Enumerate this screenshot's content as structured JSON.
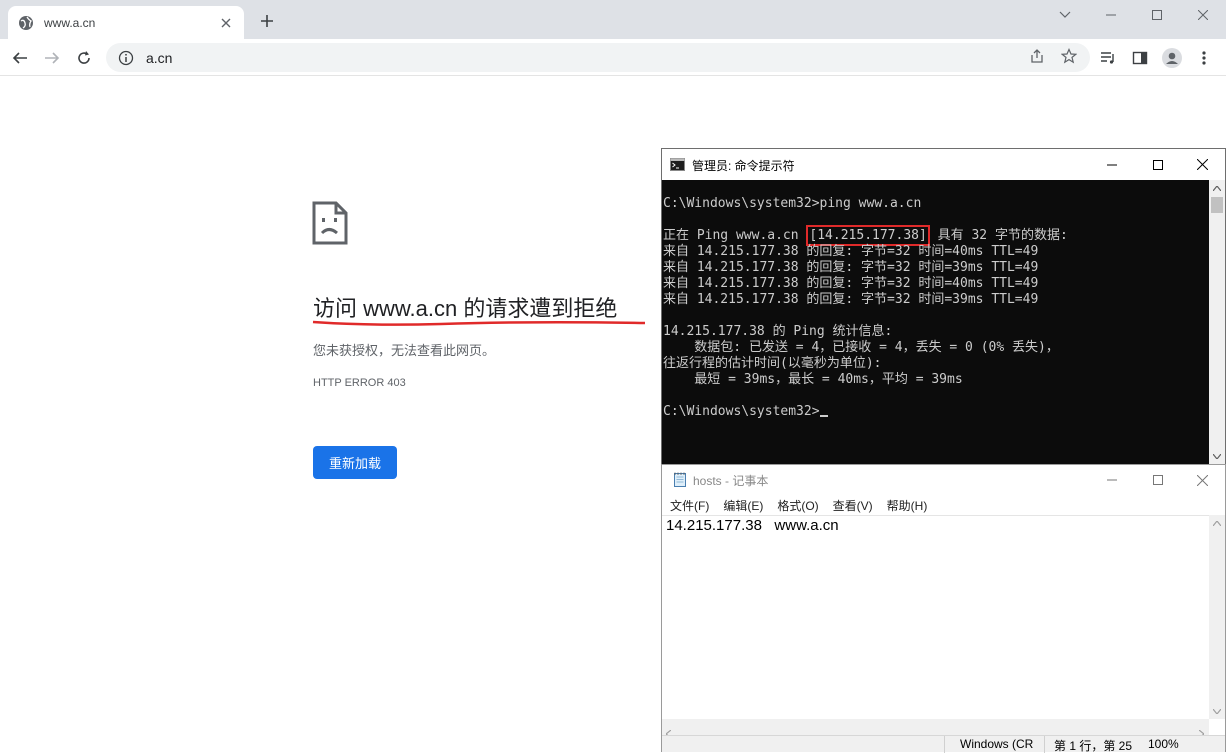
{
  "browser": {
    "tab_title": "www.a.cn",
    "url": "a.cn"
  },
  "error_page": {
    "title": "访问 www.a.cn 的请求遭到拒绝",
    "subtitle": "您未获授权，无法查看此网页。",
    "code": "HTTP ERROR 403",
    "reload_label": "重新加载",
    "underline_color": "#e02a2a"
  },
  "cmd": {
    "title": "管理员: 命令提示符",
    "lines": {
      "l1": "C:\\Windows\\system32>ping www.a.cn",
      "l3_pre": "正在 Ping www.a.cn ",
      "l3_ip": "[14.215.177.38]",
      "l3_post": " 具有 32 字节的数据:",
      "l4": "来自 14.215.177.38 的回复: 字节=32 时间=40ms TTL=49",
      "l5": "来自 14.215.177.38 的回复: 字节=32 时间=39ms TTL=49",
      "l6": "来自 14.215.177.38 的回复: 字节=32 时间=40ms TTL=49",
      "l7": "来自 14.215.177.38 的回复: 字节=32 时间=39ms TTL=49",
      "l9": "14.215.177.38 的 Ping 统计信息:",
      "l10": "    数据包: 已发送 = 4，已接收 = 4，丢失 = 0 (0% 丢失)，",
      "l11": "往返行程的估计时间(以毫秒为单位):",
      "l12": "    最短 = 39ms，最长 = 40ms，平均 = 39ms",
      "l14": "C:\\Windows\\system32>"
    }
  },
  "notepad": {
    "title": "hosts - 记事本",
    "menu": [
      "文件(F)",
      "编辑(E)",
      "格式(O)",
      "查看(V)",
      "帮助(H)"
    ],
    "content": "14.215.177.38   www.a.cn",
    "status": {
      "encoding": "Windows (CR",
      "position": "第 1 行，第 25",
      "zoom": "100%"
    }
  },
  "colors": {
    "reload_button": "#1a73e8",
    "highlight_box": "#e02a2a"
  }
}
